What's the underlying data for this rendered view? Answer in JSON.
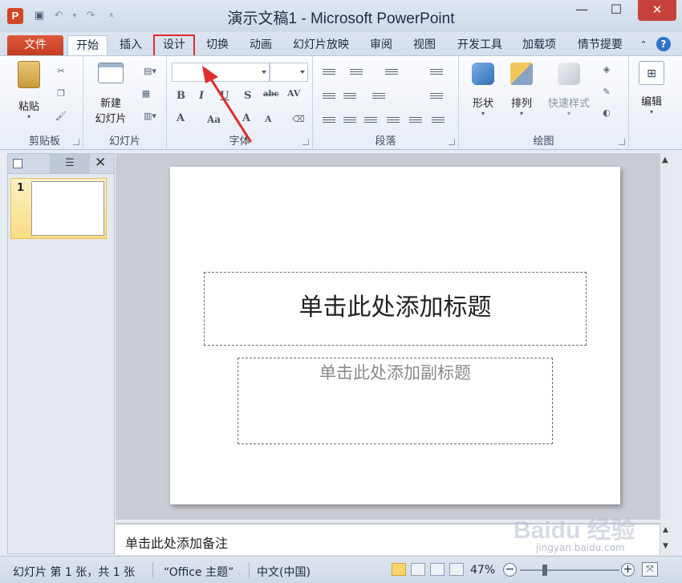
{
  "window": {
    "title": "演示文稿1 - Microsoft PowerPoint",
    "app_badge": "P"
  },
  "tabs": {
    "file": "文件",
    "home": "开始",
    "insert": "插入",
    "design": "设计",
    "transitions": "切换",
    "animations": "动画",
    "slideshow": "幻灯片放映",
    "review": "审阅",
    "view": "视图",
    "developer": "开发工具",
    "addins": "加载项",
    "storyboard": "情节提要"
  },
  "ribbon": {
    "clipboard": {
      "label": "剪贴板",
      "paste": "粘贴"
    },
    "slides": {
      "label": "幻灯片",
      "new_slide_1": "新建",
      "new_slide_2": "幻灯片"
    },
    "font": {
      "label": "字体"
    },
    "paragraph": {
      "label": "段落"
    },
    "drawing": {
      "label": "绘图",
      "shapes": "形状",
      "arrange": "排列",
      "quick_styles": "快速样式"
    },
    "editing": {
      "label": "编辑"
    }
  },
  "slide_pane": {
    "slide_number": "1"
  },
  "slide": {
    "title_placeholder": "单击此处添加标题",
    "subtitle_placeholder": "单击此处添加副标题"
  },
  "notes": {
    "placeholder": "单击此处添加备注"
  },
  "status": {
    "slide_info": "幻灯片 第 1 张，共 1 张",
    "theme": "“Office 主题”",
    "language": "中文(中国)",
    "zoom": "47%"
  },
  "watermark": {
    "text": "Baidu 经验",
    "url": "jingyan.baidu.com"
  },
  "colors": {
    "file_tab": "#d24726",
    "highlight_box": "#e02b2b",
    "arrow": "#e02b2b"
  }
}
